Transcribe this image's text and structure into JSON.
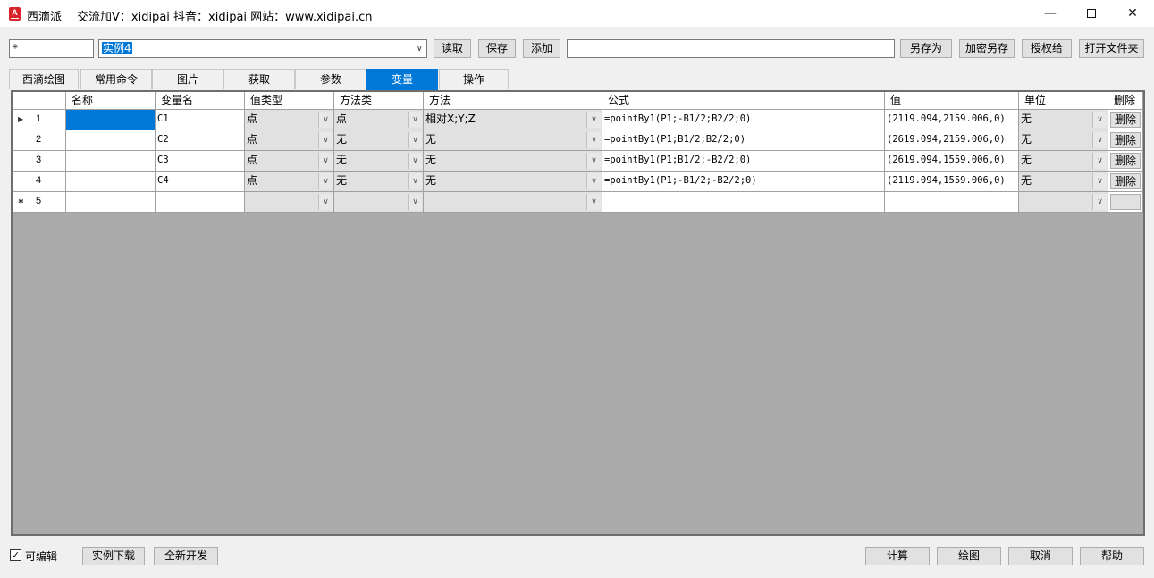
{
  "window": {
    "title": "西滴派",
    "info": "交流加V：xidipai   抖音：xidipai   网站：www.xidipai.cn",
    "app_icon_letter": "A",
    "min_glyph": "—",
    "close_glyph": "✕"
  },
  "toolbar": {
    "filter_value": "*",
    "instance_value": "实例4",
    "read_label": "读取",
    "save_label": "保存",
    "add_label": "添加",
    "name_value": "",
    "save_as_label": "另存为",
    "encrypt_save_as_label": "加密另存",
    "authorize_label": "授权给",
    "open_folder_label": "打开文件夹"
  },
  "tabs": [
    "西滴绘图",
    "常用命令",
    "图片",
    "获取",
    "参数",
    "变量",
    "操作"
  ],
  "active_tab_index": 5,
  "grid": {
    "columns": [
      "名称",
      "变量名",
      "值类型",
      "方法类",
      "方法",
      "公式",
      "值",
      "单位",
      "删除"
    ],
    "rows": [
      {
        "num": "1",
        "marker": "▶",
        "name": "",
        "var": "C1",
        "type": "点",
        "mclass": "点",
        "method": "相对X;Y;Z",
        "formula": "=pointBy1(P1;-B1/2;B2/2;0)",
        "value": "(2119.094,2159.006,0)",
        "unit": "无",
        "del": "删除"
      },
      {
        "num": "2",
        "marker": "",
        "name": "",
        "var": "C2",
        "type": "点",
        "mclass": "无",
        "method": "无",
        "formula": "=pointBy1(P1;B1/2;B2/2;0)",
        "value": "(2619.094,2159.006,0)",
        "unit": "无",
        "del": "删除"
      },
      {
        "num": "3",
        "marker": "",
        "name": "",
        "var": "C3",
        "type": "点",
        "mclass": "无",
        "method": "无",
        "formula": "=pointBy1(P1;B1/2;-B2/2;0)",
        "value": "(2619.094,1559.006,0)",
        "unit": "无",
        "del": "删除"
      },
      {
        "num": "4",
        "marker": "",
        "name": "",
        "var": "C4",
        "type": "点",
        "mclass": "无",
        "method": "无",
        "formula": "=pointBy1(P1;-B1/2;-B2/2;0)",
        "value": "(2119.094,1559.006,0)",
        "unit": "无",
        "del": "删除"
      },
      {
        "num": "5",
        "marker": "✱",
        "name": "",
        "var": "",
        "type": "",
        "mclass": "",
        "method": "",
        "formula": "",
        "value": "",
        "unit": "",
        "del": ""
      }
    ]
  },
  "footer": {
    "editable_label": "可编辑",
    "editable_checked": true,
    "download_label": "实例下载",
    "new_dev_label": "全新开发",
    "calc_label": "计算",
    "draw_label": "绘图",
    "cancel_label": "取消",
    "help_label": "帮助"
  }
}
